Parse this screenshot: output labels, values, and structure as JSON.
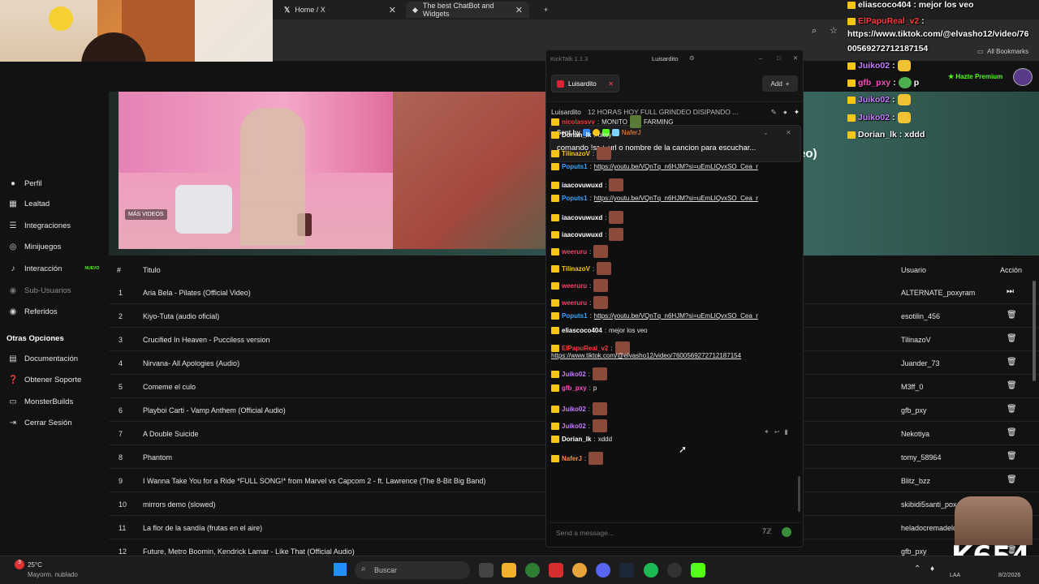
{
  "browser": {
    "tabs": [
      {
        "label": "Home / X"
      },
      {
        "label": "The best ChatBot and Widgets"
      }
    ],
    "bookmarks_label": "All Bookmarks"
  },
  "site": {
    "mas_videos": "MÁS VIDEOS",
    "hero_fragment": "eo)",
    "sidebar": {
      "items": [
        {
          "label": "Perfil",
          "icon": "user-icon"
        },
        {
          "label": "Lealtad",
          "icon": "loyalty-icon"
        },
        {
          "label": "Integraciones",
          "icon": "list-icon"
        },
        {
          "label": "Minijuegos",
          "icon": "gamepad-icon"
        },
        {
          "label": "Interacción",
          "icon": "music-icon",
          "badge": "NUEVO"
        },
        {
          "label": "Sub-Usuarios",
          "icon": "users-icon"
        },
        {
          "label": "Referidos",
          "icon": "users-icon"
        }
      ],
      "section": "Otras Opciones",
      "other": [
        {
          "label": "Documentación",
          "icon": "document-icon"
        },
        {
          "label": "Obtener Soporte",
          "icon": "help-icon"
        },
        {
          "label": "MonsterBuilds",
          "icon": "monitor-icon"
        },
        {
          "label": "Cerrar Sesión",
          "icon": "logout-icon"
        }
      ]
    },
    "table": {
      "headers": {
        "num": "#",
        "title": "Titulo",
        "user": "Usuario",
        "action": "Acción"
      },
      "rows": [
        {
          "num": "1",
          "title": "Aria Bela - Pilates (Official Video)",
          "user": "ALTERNATE_poxyram",
          "action": "skip"
        },
        {
          "num": "2",
          "title": "Kiyo-Tuta (audio oficial)",
          "user": "esotilin_456",
          "action": "delete"
        },
        {
          "num": "3",
          "title": "Crucified In Heaven - Pucciless version",
          "user": "TilinazoV",
          "action": "delete"
        },
        {
          "num": "4",
          "title": "Nirvana- All Apologies (Audio)",
          "user": "Juander_73",
          "action": "delete"
        },
        {
          "num": "5",
          "title": "Comeme el culo",
          "user": "M3ff_0",
          "action": "delete"
        },
        {
          "num": "6",
          "title": "Playboi Carti - Vamp Anthem (Official Audio)",
          "user": "gfb_pxy",
          "action": "delete"
        },
        {
          "num": "7",
          "title": "A Double Suicide",
          "user": "Nekotiya",
          "action": "delete"
        },
        {
          "num": "8",
          "title": "Phantom",
          "user": "tomy_58964",
          "action": "delete"
        },
        {
          "num": "9",
          "title": "I Wanna Take You for a Ride *FULL SONG!* from Marvel vs Capcom 2 - ft. Lawrence (The 8-Bit Big Band)",
          "user": "Blitz_bzz",
          "action": "delete"
        },
        {
          "num": "10",
          "title": "mirrors demo (slowed)",
          "user": "skibidi5santi_pox",
          "action": "delete"
        },
        {
          "num": "11",
          "title": "La flor de la sandía (frutas en el aire)",
          "user": "heladocremadelc",
          "action": "delete"
        },
        {
          "num": "12",
          "title": "Future, Metro Boomin, Kendrick Lamar - Like That (Official Audio)",
          "user": "gfb_pxy",
          "action": "delete"
        }
      ]
    }
  },
  "overlay": {
    "lines": [
      {
        "user": "eliascoco404",
        "text": ": mejor los veo",
        "color": "#ffffff"
      },
      {
        "user": "ElPapuReal_v2",
        "text": ":",
        "color": "#ff3d3d"
      },
      {
        "user": "",
        "text": "https://www.tiktok.com/@elvasho12/video/76",
        "color": "#ffffff"
      },
      {
        "user": "",
        "text": "00569272712187154",
        "color": "#ffffff"
      },
      {
        "user": "Juiko02",
        "text": ":",
        "color": "#c77dff"
      },
      {
        "user": "gfb_pxy",
        "text": ":",
        "color": "#ff4fbf"
      },
      {
        "user": "Juiko02",
        "text": ":",
        "color": "#c77dff"
      },
      {
        "user": "Juiko02",
        "text": ":",
        "color": "#c77dff"
      },
      {
        "user": "Dorian_lk",
        "text": ": xddd",
        "color": "#ffffff"
      }
    ],
    "emote_p": "p",
    "hazte_premium": "Hazte Premium"
  },
  "kicktalk": {
    "title": "KickTalk 1.1.3",
    "user": "Luisardito",
    "tab_label": "Luisardito",
    "add_label": "Add",
    "stream_user": "Luisardito",
    "stream_title": "12 HORAS HOY FULL GRINDEO DISIPANDO ...",
    "pinned_sent_by": "Sent by",
    "pinned_author": "NaferJ",
    "pinned_text": "comando !sr + url o nombre de la cancion para escuchar...",
    "messages": [
      {
        "user": "nicolassvv",
        "text": "MONITO",
        "extra": "FARMING",
        "color": "#ff3d3d"
      },
      {
        "user": "Dorian_lk",
        "text": "okey",
        "color": "#ffffff"
      },
      {
        "user": "TilinazoV",
        "text": "",
        "color": "#f5c518"
      },
      {
        "user": "Poputs1",
        "text": "https://youtu.be/VQnTq_n6HJM?si=uEmLIQvxSO_Cea_r",
        "color": "#3da5ff",
        "link": true
      },
      {
        "user": "iaacovuwuxd",
        "text": "",
        "color": "#ffffff"
      },
      {
        "user": "Poputs1",
        "text": "https://youtu.be/VQnTq_n6HJM?si=uEmLIQvxSO_Cea_r",
        "color": "#3da5ff",
        "link": true
      },
      {
        "user": "iaacovuwuxd",
        "text": "",
        "color": "#ffffff"
      },
      {
        "user": "iaacovuwuxd",
        "text": "",
        "color": "#ffffff"
      },
      {
        "user": "weeruru",
        "text": "",
        "color": "#ff3d6a"
      },
      {
        "user": "TilinazoV",
        "text": "",
        "color": "#f5c518"
      },
      {
        "user": "weeruru",
        "text": "",
        "color": "#ff3d6a"
      },
      {
        "user": "weeruru",
        "text": "",
        "color": "#ff3d6a"
      },
      {
        "user": "Poputs1",
        "text": "https://youtu.be/VQnTq_n6HJM?si=uEmLIQvxSO_Cea_r",
        "color": "#3da5ff",
        "link": true
      },
      {
        "user": "eliascoco404",
        "text": "mejor los veo",
        "color": "#ffffff"
      },
      {
        "user": "ElPapuReal_v2",
        "text": "",
        "color": "#ff3d3d"
      },
      {
        "user": "",
        "text": "https://www.tiktok.com/@elvasho12/video/7600569272712187154",
        "color": "#ffffff",
        "link": true
      },
      {
        "user": "Juiko02",
        "text": "",
        "color": "#c77dff"
      },
      {
        "user": "gfb_pxy",
        "text": "p",
        "color": "#ff4fbf"
      },
      {
        "user": "Juiko02",
        "text": "",
        "color": "#c77dff"
      },
      {
        "user": "Juiko02",
        "text": "",
        "color": "#c77dff"
      },
      {
        "user": "Dorian_lk",
        "text": "xddd",
        "color": "#ffffff"
      },
      {
        "user": "NaferJ",
        "text": "",
        "color": "#ff8c42"
      }
    ],
    "input_placeholder": "Send a message..."
  },
  "taskbar": {
    "weather_temp": "25°C",
    "weather_desc": "Mayorm. nublado",
    "search_label": "Buscar",
    "tray_lang": "LAA",
    "date": "8/2/2026"
  },
  "watermark": "K654"
}
